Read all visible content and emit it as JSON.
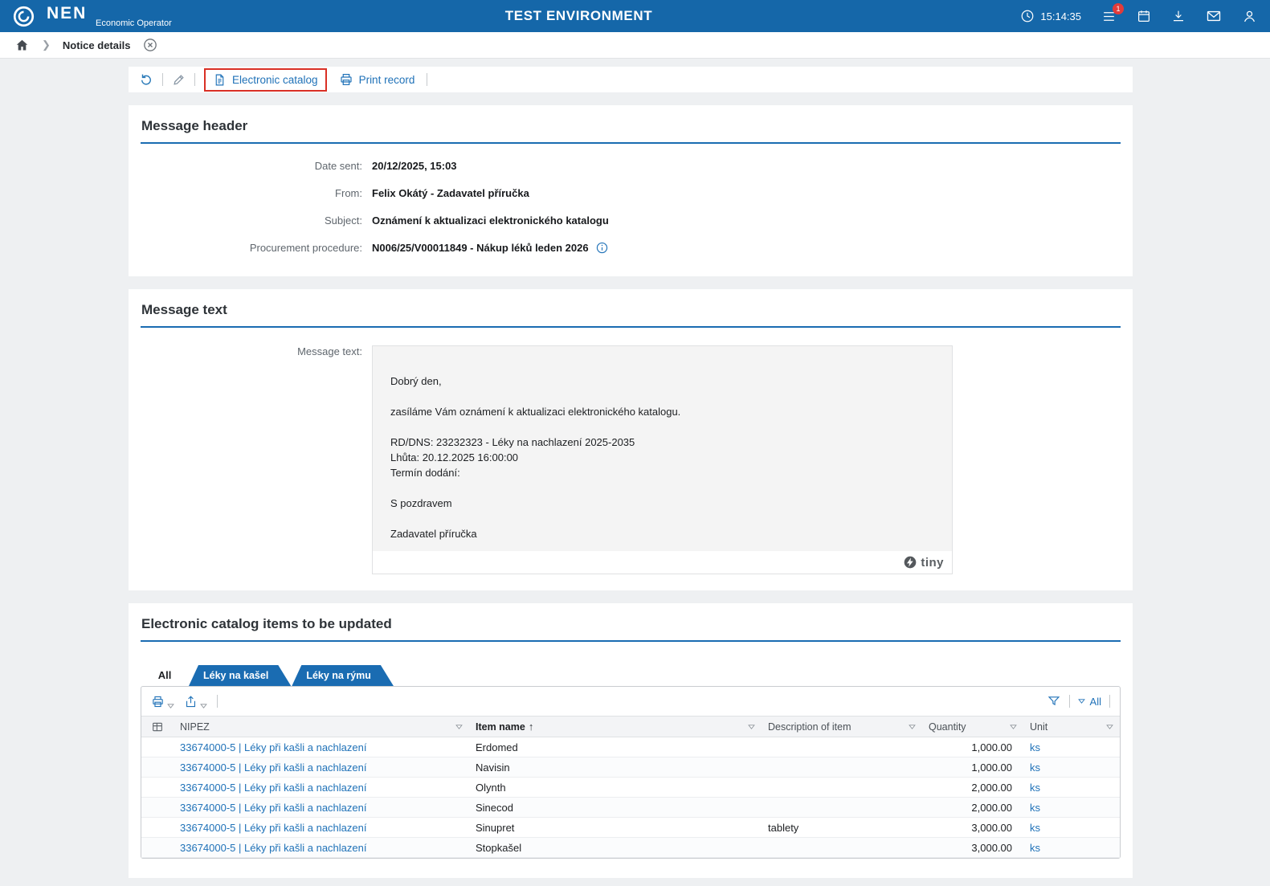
{
  "header": {
    "brand": "NEN",
    "brand_sub": "Economic Operator",
    "env_title": "TEST ENVIRONMENT",
    "time": "15:14:35",
    "badge": "1"
  },
  "breadcrumb": {
    "current": "Notice details"
  },
  "toolbar": {
    "catalog_btn": "Electronic catalog",
    "print_btn": "Print record"
  },
  "message_header": {
    "title": "Message header",
    "fields": [
      {
        "label": "Date sent:",
        "value": "20/12/2025, 15:03"
      },
      {
        "label": "From:",
        "value": "Felix Okátý - Zadavatel příručka"
      },
      {
        "label": "Subject:",
        "value": "Oznámení k aktualizaci elektronického katalogu"
      },
      {
        "label": "Procurement procedure:",
        "value": "N006/25/V00011849 - Nákup léků leden 2026"
      }
    ]
  },
  "message_text": {
    "title": "Message text",
    "field_label": "Message text:",
    "lines": [
      "Dobrý den,",
      "",
      "zasíláme Vám oznámení k aktualizaci elektronického katalogu.",
      "",
      "RD/DNS: 23232323 - Léky na nachlazení 2025-2035",
      "Lhůta: 20.12.2025 16:00:00",
      "Termín dodání:",
      "",
      "S pozdravem",
      "",
      "Zadavatel příručka"
    ],
    "editor_brand": "tiny"
  },
  "catalog": {
    "title": "Electronic catalog items to be updated",
    "tabs": {
      "all": "All",
      "tab1": "Léky na kašel",
      "tab2": "Léky na rýmu"
    },
    "toolbar_all": "All",
    "columns": {
      "nipez": "NIPEZ",
      "item": "Item name",
      "desc": "Description of item",
      "qty": "Quantity",
      "unit": "Unit"
    },
    "rows": [
      {
        "nipez": "33674000-5 | Léky při kašli a nachlazení",
        "item": "Erdomed",
        "desc": "",
        "qty": "1,000.00",
        "unit": "ks"
      },
      {
        "nipez": "33674000-5 | Léky při kašli a nachlazení",
        "item": "Navisin",
        "desc": "",
        "qty": "1,000.00",
        "unit": "ks"
      },
      {
        "nipez": "33674000-5 | Léky při kašli a nachlazení",
        "item": "Olynth",
        "desc": "",
        "qty": "2,000.00",
        "unit": "ks"
      },
      {
        "nipez": "33674000-5 | Léky při kašli a nachlazení",
        "item": "Sinecod",
        "desc": "",
        "qty": "2,000.00",
        "unit": "ks"
      },
      {
        "nipez": "33674000-5 | Léky při kašli a nachlazení",
        "item": "Sinupret",
        "desc": "tablety",
        "qty": "3,000.00",
        "unit": "ks"
      },
      {
        "nipez": "33674000-5 | Léky při kašli a nachlazení",
        "item": "Stopkašel",
        "desc": "",
        "qty": "3,000.00",
        "unit": "ks"
      }
    ]
  }
}
